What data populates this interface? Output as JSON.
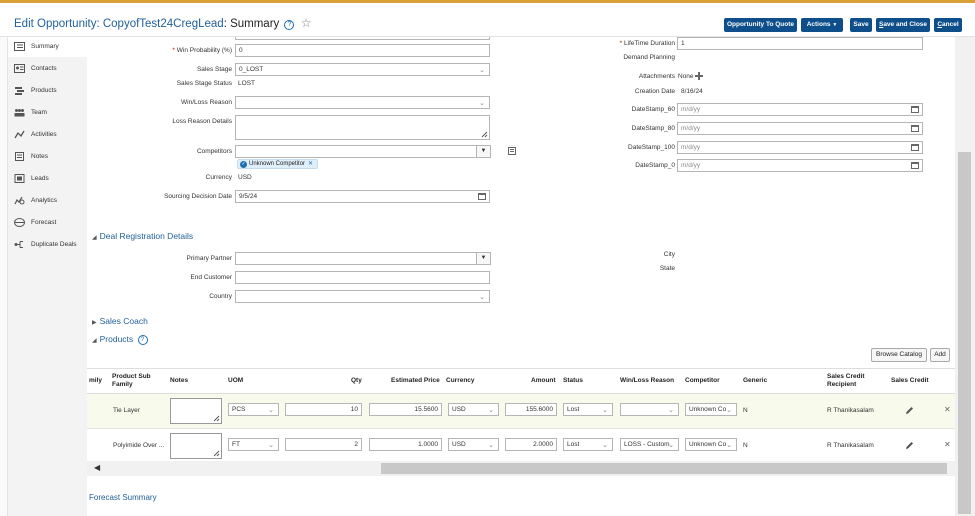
{
  "header": {
    "title_prefix": "Edit Opportunity: CopyofTest24CregLead",
    "title_suffix": ": Summary",
    "help": "?",
    "buttons": {
      "quote": "Opportunity To Quote",
      "actions": "Actions",
      "actions_caret": "▼",
      "save": "Save",
      "save_close_first": "S",
      "save_close_rest": "ave and Close",
      "cancel_first": "C",
      "cancel_rest": "ancel"
    }
  },
  "nav": {
    "items": [
      {
        "label": "Summary",
        "icon": "summary-icon"
      },
      {
        "label": "Contacts",
        "icon": "contacts-icon"
      },
      {
        "label": "Products",
        "icon": "products-icon"
      },
      {
        "label": "Team",
        "icon": "team-icon"
      },
      {
        "label": "Activities",
        "icon": "activities-icon"
      },
      {
        "label": "Notes",
        "icon": "notes-icon"
      },
      {
        "label": "Leads",
        "icon": "leads-icon"
      },
      {
        "label": "Analytics",
        "icon": "analytics-icon"
      },
      {
        "label": "Forecast",
        "icon": "forecast-icon"
      },
      {
        "label": "Duplicate Deals",
        "icon": "duplicate-deals-icon"
      }
    ]
  },
  "form": {
    "win_probability": {
      "label": "Win Probability (%)",
      "value": "0"
    },
    "sales_stage": {
      "label": "Sales Stage",
      "value": "0_LOST"
    },
    "sales_stage_status": {
      "label": "Sales Stage Status",
      "value": "LOST"
    },
    "win_loss_reason": {
      "label": "Win/Loss Reason",
      "value": ""
    },
    "loss_reason_details": {
      "label": "Loss Reason Details",
      "value": ""
    },
    "competitors": {
      "label": "Competitors",
      "value": "",
      "chip": "Unknown Competitor"
    },
    "currency": {
      "label": "Currency",
      "value": "USD"
    },
    "sourcing_decision_date": {
      "label": "Sourcing Decision Date",
      "value": "9/5/24"
    },
    "lifetime_duration": {
      "label": "LifeTime Duration",
      "value": "1"
    },
    "demand_planning": {
      "label": "Demand Planning"
    },
    "attachments": {
      "label": "Attachments",
      "value": "None"
    },
    "creation_date": {
      "label": "Creation Date",
      "value": "8/16/24"
    },
    "datestamp_60": {
      "label": "DateStamp_60",
      "placeholder": "m/d/yy"
    },
    "datestamp_80": {
      "label": "DateStamp_80",
      "placeholder": "m/d/yy"
    },
    "datestamp_100": {
      "label": "DateStamp_100",
      "placeholder": "m/d/yy"
    },
    "datestamp_0": {
      "label": "DateStamp_0",
      "placeholder": "m/d/yy"
    }
  },
  "deal_registration": {
    "title": "Deal Registration Details",
    "primary_partner": {
      "label": "Primary Partner",
      "value": ""
    },
    "end_customer": {
      "label": "End Customer",
      "value": ""
    },
    "country": {
      "label": "Country",
      "value": ""
    },
    "city": {
      "label": "City"
    },
    "state": {
      "label": "State"
    }
  },
  "sales_coach": {
    "title": "Sales Coach"
  },
  "products": {
    "title": "Products",
    "help": "?",
    "browse_catalog": "Browse Catalog",
    "add": "Add",
    "columns": {
      "family": "mily",
      "product_sub_family_1": "Product Sub",
      "product_sub_family_2": "Family",
      "notes": "Notes",
      "uom": "UOM",
      "qty": "Qty",
      "estimated_price": "Estimated Price",
      "currency": "Currency",
      "amount": "Amount",
      "status": "Status",
      "win_loss_reason": "Win/Loss Reason",
      "competitor": "Competitor",
      "generic": "Generic",
      "sales_credit_recipient_1": "Sales Credit",
      "sales_credit_recipient_2": "Recipient",
      "sales_credit": "Sales Credit"
    },
    "rows": [
      {
        "sub_family": "Tie Layer",
        "uom": "PCS",
        "qty": "10",
        "price": "15.5600",
        "currency": "USD",
        "amount": "155.6000",
        "status": "Lost",
        "win_loss": "",
        "competitor": "Unknown Co",
        "generic": "N",
        "recipient": "R Thanikasalam"
      },
      {
        "sub_family": "Polyimide Over ...",
        "uom": "FT",
        "qty": "2",
        "price": "1.0000",
        "currency": "USD",
        "amount": "2.0000",
        "status": "Lost",
        "win_loss": "LOSS - Custom",
        "competitor": "Unknown Co",
        "generic": "N",
        "recipient": "R Thanikasalam"
      }
    ]
  },
  "forecast_summary": {
    "title": "Forecast Summary"
  }
}
